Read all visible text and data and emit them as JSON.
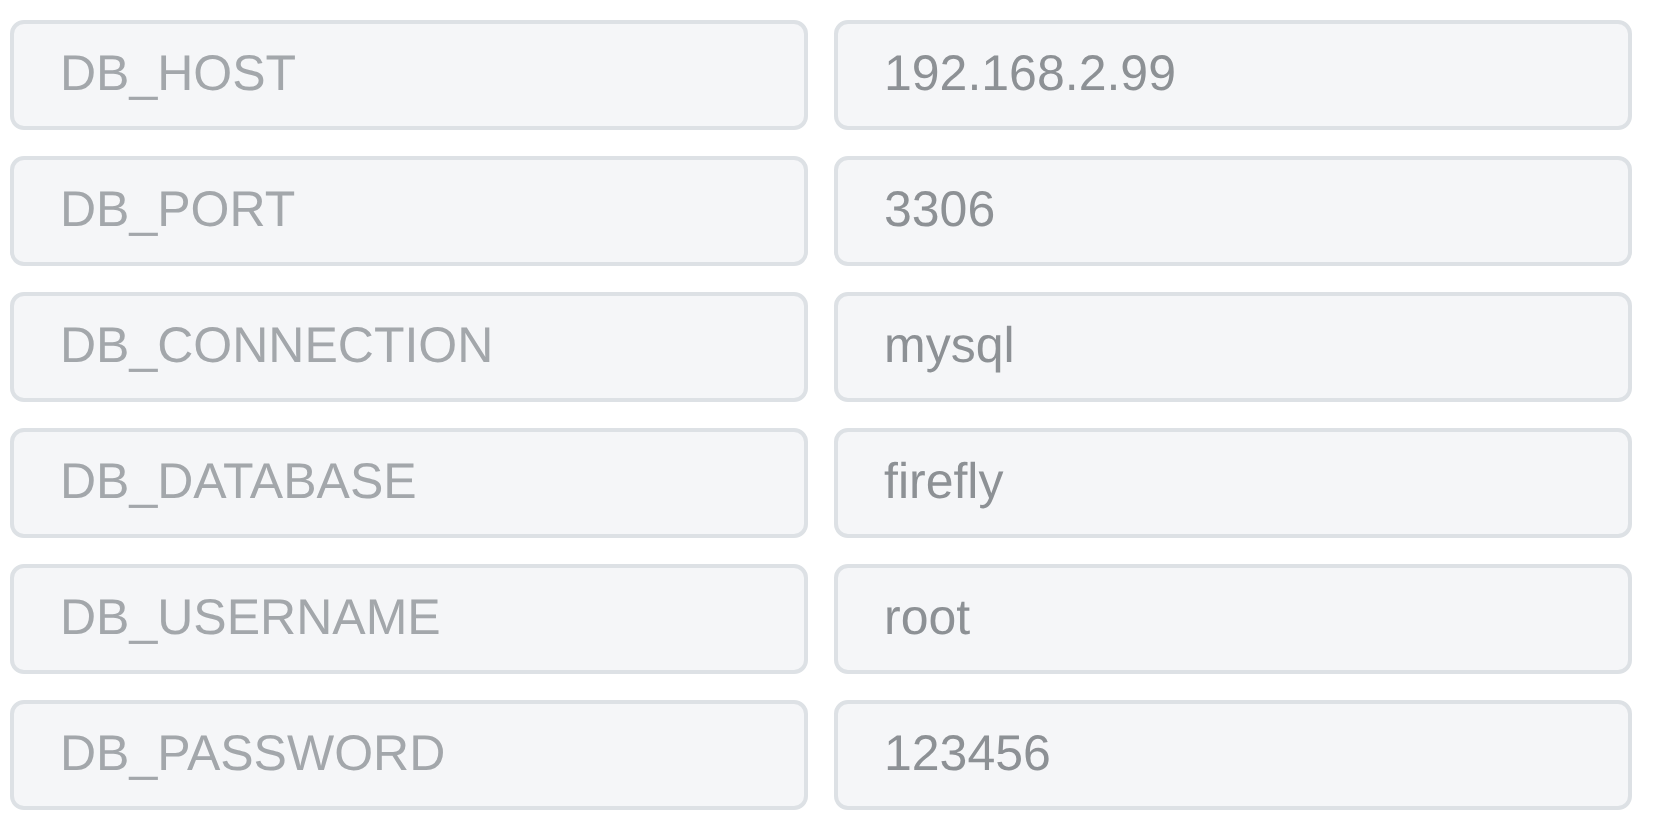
{
  "env_vars": [
    {
      "key": "DB_HOST",
      "value": "192.168.2.99"
    },
    {
      "key": "DB_PORT",
      "value": "3306"
    },
    {
      "key": "DB_CONNECTION",
      "value": "mysql"
    },
    {
      "key": "DB_DATABASE",
      "value": "firefly"
    },
    {
      "key": "DB_USERNAME",
      "value": "root"
    },
    {
      "key": "DB_PASSWORD",
      "value": "123456"
    }
  ]
}
